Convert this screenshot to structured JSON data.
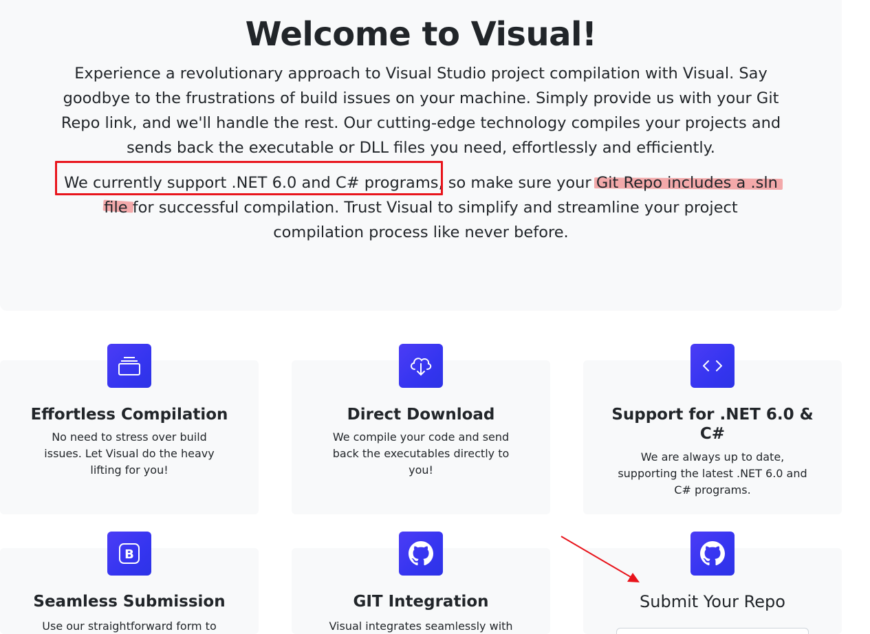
{
  "hero": {
    "title": "Welcome to Visual!",
    "paragraph1": "Experience a revolutionary approach to Visual Studio project compilation with Visual. Say goodbye to the frustrations of build issues on your machine. Simply provide us with your Git Repo link, and we'll handle the rest. Our cutting-edge technology compiles your projects and sends back the executable or DLL files you need, effortlessly and efficiently.",
    "paragraph2": "We currently support .NET 6.0 and C# programs, so make sure your Git Repo includes a .sln file for successful compilation. Trust Visual to simplify and streamline your project compilation process like never before."
  },
  "features": [
    {
      "icon": "stack-icon",
      "title": "Effortless Compilation",
      "desc": "No need to stress over build issues. Let Visual do the heavy lifting for you!"
    },
    {
      "icon": "cloud-download-icon",
      "title": "Direct Download",
      "desc": "We compile your code and send back the executables directly to you!"
    },
    {
      "icon": "code-icon",
      "title": "Support for .NET 6.0 & C#",
      "desc": "We are always up to date, supporting the latest .NET 6.0 and C# programs."
    },
    {
      "icon": "bootstrap-icon",
      "title": "Seamless Submission",
      "desc": "Use our straightforward form to"
    },
    {
      "icon": "github-icon",
      "title": "GIT Integration",
      "desc": "Visual integrates seamlessly with"
    },
    {
      "icon": "github-icon",
      "title": "Submit Your Repo",
      "desc": ""
    }
  ],
  "colors": {
    "accent": "#3535f0",
    "annotation": "#e8141b",
    "highlight": "#ee6868"
  }
}
